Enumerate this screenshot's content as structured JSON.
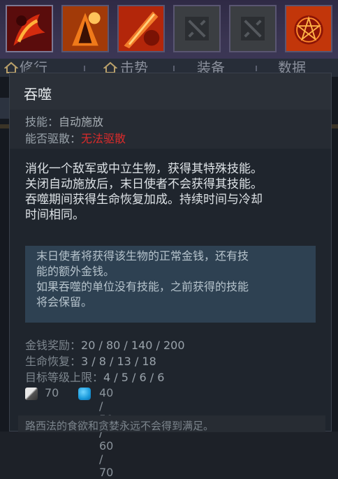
{
  "tabs": [
    {
      "label": "修行"
    },
    {
      "label": "击势"
    },
    {
      "label": "装备"
    },
    {
      "label": "数据"
    }
  ],
  "abilities": [
    {
      "icon": "doom-devour-icon"
    },
    {
      "icon": "scorched-earth-icon"
    },
    {
      "icon": "infernal-blade-icon"
    },
    {
      "icon": "empty-slot-icon"
    },
    {
      "icon": "empty-slot-icon"
    },
    {
      "icon": "doom-ultimate-icon"
    }
  ],
  "tooltip": {
    "title": "吞噬",
    "ability_label": "技能：",
    "ability_value": "自动施放",
    "dispel_label": "能否驱散：",
    "dispel_value": "无法驱散",
    "description": [
      "消化一个敌军或中立生物，获得其特殊技能。",
      "关闭自动施放后，末日使者不会获得其技能。",
      "吞噬期间获得生命恢复加成。持续时间与冷却",
      "时间相同。"
    ],
    "note": [
      "末日使者将获得该生物的正常金钱，还有技",
      "能的额外金钱。",
      "如果吞噬的单位没有技能，之前获得的技能",
      "将会保留。"
    ],
    "stats": [
      {
        "label": "金钱奖励：",
        "value": "20 / 80 / 140 / 200"
      },
      {
        "label": "生命恢复：",
        "value": "3 / 8 / 13 / 18"
      },
      {
        "label": "目标等级上限：",
        "value": "4 / 5 / 6 / 6"
      }
    ],
    "cooldown": "70",
    "mana": "40 / 50 / 60 / 70",
    "lore": "路西法的食欲和贪婪永远不会得到满足。"
  },
  "colors": {
    "dispel_red": "#dc2b2b",
    "note_bg": "#2e4152",
    "mana_blue": "#1a9bdc"
  }
}
